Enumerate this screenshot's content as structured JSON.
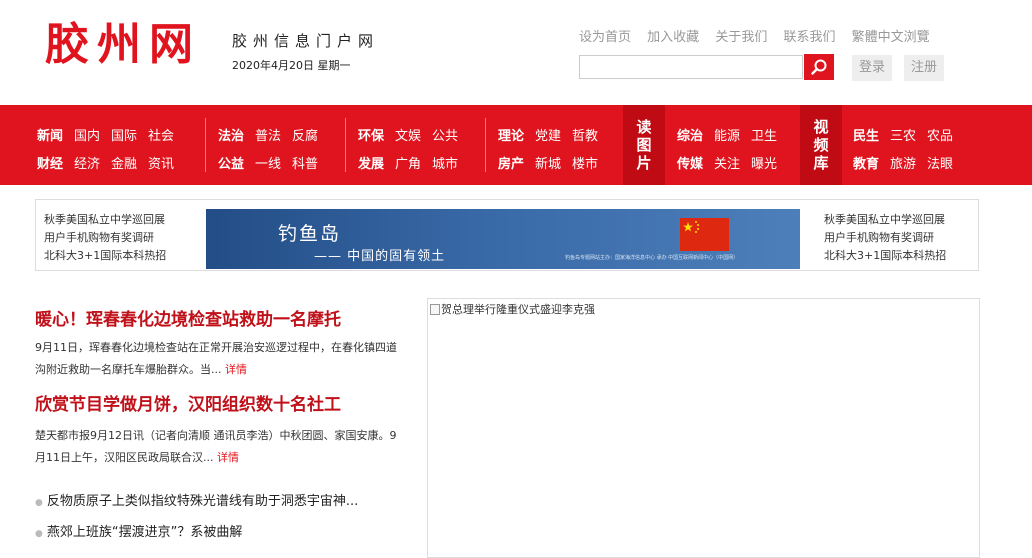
{
  "header": {
    "logo": "胶州网",
    "tagline": "胶州信息门户网",
    "date": "2020年4月20日 星期一",
    "top_links": [
      "设为首页",
      "加入收藏",
      "关于我们",
      "联系我们",
      "繁體中文浏覽"
    ],
    "search": {
      "value": "",
      "placeholder": ""
    },
    "search_icon": "search-icon",
    "login": "登录",
    "register": "注册",
    "accent": "#e0141e"
  },
  "nav": {
    "groups": [
      {
        "row1": [
          {
            "t": "新闻",
            "b": true
          },
          {
            "t": "国内"
          },
          {
            "t": "国际"
          },
          {
            "t": "社会"
          }
        ],
        "row2": [
          {
            "t": "财经",
            "b": true
          },
          {
            "t": "经济"
          },
          {
            "t": "金融"
          },
          {
            "t": "资讯"
          }
        ]
      },
      {
        "row1": [
          {
            "t": "法治",
            "b": true
          },
          {
            "t": "普法"
          },
          {
            "t": "反腐"
          }
        ],
        "row2": [
          {
            "t": "公益",
            "b": true
          },
          {
            "t": "一线"
          },
          {
            "t": "科普"
          }
        ]
      },
      {
        "row1": [
          {
            "t": "环保",
            "b": true
          },
          {
            "t": "文娱"
          },
          {
            "t": "公共"
          }
        ],
        "row2": [
          {
            "t": "发展",
            "b": true
          },
          {
            "t": "广角"
          },
          {
            "t": "城市"
          }
        ]
      },
      {
        "row1": [
          {
            "t": "理论",
            "b": true
          },
          {
            "t": "党建"
          },
          {
            "t": "哲教"
          }
        ],
        "row2": [
          {
            "t": "房产",
            "b": true
          },
          {
            "t": "新城"
          },
          {
            "t": "楼市"
          }
        ]
      },
      {
        "row1": [
          {
            "t": "综治",
            "b": true
          },
          {
            "t": "能源"
          },
          {
            "t": "卫生"
          }
        ],
        "row2": [
          {
            "t": "传媒",
            "b": true
          },
          {
            "t": "关注"
          },
          {
            "t": "曝光"
          }
        ]
      },
      {
        "row1": [
          {
            "t": "民生",
            "b": true
          },
          {
            "t": "三农"
          },
          {
            "t": "农品"
          }
        ],
        "row2": [
          {
            "t": "教育",
            "b": true
          },
          {
            "t": "旅游"
          },
          {
            "t": "法眼"
          }
        ]
      }
    ],
    "vertical": [
      "读图片",
      "视频库"
    ]
  },
  "strip": {
    "left_links": [
      "秋季美国私立中学巡回展",
      "用户手机购物有奖调研",
      "北科大3+1国际本科热招"
    ],
    "right_links": [
      "秋季美国私立中学巡回展",
      "用户手机购物有奖调研",
      "北科大3+1国际本科热招"
    ],
    "banner": {
      "title": "钓鱼岛",
      "subtitle": "—— 中国的固有领土",
      "small": "钓鱼岛专题网站主办：国家海洋信息中心 承办 中国互联网新闻中心（中国网）",
      "flag_color": "#de2910"
    }
  },
  "news": {
    "items": [
      {
        "title": "暖心！珲春春化边境检查站救助一名摩托",
        "summary": "9月11日，珲春春化边境检查站在正常开展治安巡逻过程中，在春化镇四道沟附近救助一名摩托车爆胎群众。当...",
        "detail": "详情"
      },
      {
        "title": "欣赏节目学做月饼，汉阳组织数十名社工",
        "summary": "楚天都市报9月12日讯（记者向清顺 通讯员李浩）中秋团圆、家国安康。9月11日上午，汉阳区民政局联合汉...",
        "detail": "详情"
      }
    ],
    "bullets": [
      "反物质原子上类似指纹特殊光谱线有助于洞悉宇宙神...",
      "燕郊上班族“摆渡进京”？系被曲解"
    ]
  },
  "image_box": {
    "caption": "贺总理举行隆重仪式盛迎李克强"
  }
}
